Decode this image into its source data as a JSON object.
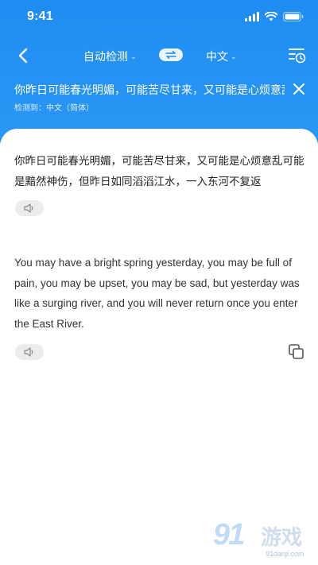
{
  "status_bar": {
    "time": "9:41"
  },
  "toolbar": {
    "source_lang": "自动检测",
    "target_lang": "中文"
  },
  "source": {
    "preview": "你昨日可能春光明媚，可能苦尽甘来，又可能是心烦意乱",
    "detected": "检测到：中文（简体）"
  },
  "result": {
    "source_text": "你昨日可能春光明媚，可能苦尽甘来，又可能是心烦意乱可能是黯然神伤，但昨日如同滔滔江水，一入东河不复返",
    "translation": "You may have a bright spring yesterday, you may be full of pain, you may be upset, you may be sad, but yesterday was like a surging river, and you will never return once you enter the East River."
  },
  "watermark": {
    "main": "91",
    "sub": "游戏",
    "url": "91danji.com"
  },
  "colors": {
    "accent": "#1f8cf2",
    "text": "#222222"
  },
  "icons": {
    "back": "chevron-left-icon",
    "swap": "swap-icon",
    "history": "history-icon",
    "close": "close-icon",
    "speaker": "speaker-icon",
    "copy": "copy-icon"
  }
}
